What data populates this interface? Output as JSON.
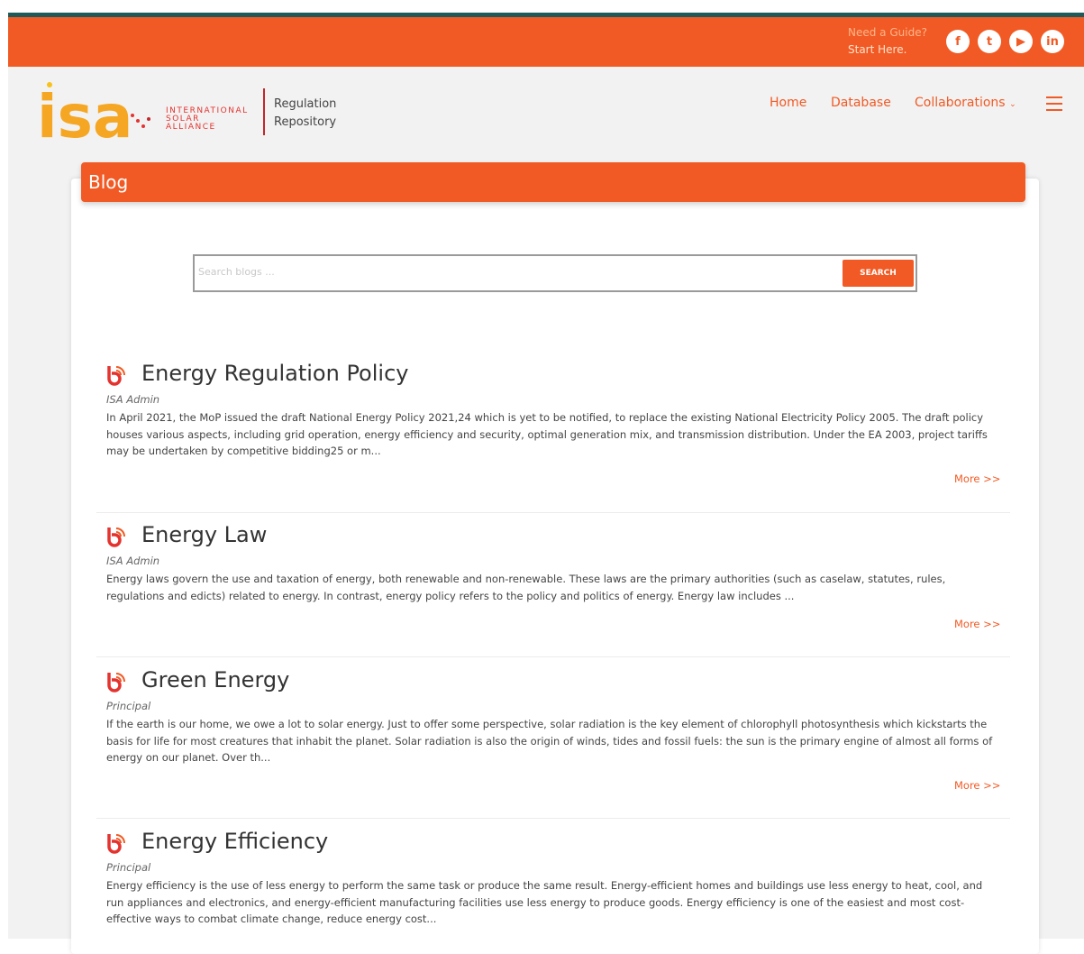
{
  "topbar": {
    "guide_line1": "Need a Guide?",
    "guide_line2": "Start Here.",
    "social": [
      {
        "icon": "facebook-icon",
        "glyph": "f"
      },
      {
        "icon": "twitter-icon",
        "glyph": "t"
      },
      {
        "icon": "youtube-icon",
        "glyph": "▶"
      },
      {
        "icon": "linkedin-icon",
        "glyph": "in"
      }
    ]
  },
  "header": {
    "logo_text": "isa",
    "logo_sub": [
      "INTERNATIONAL",
      "SOLAR",
      "ALLIANCE"
    ],
    "repo_line1": "Regulation",
    "repo_line2": "Repository",
    "nav": {
      "home": "Home",
      "database": "Database",
      "collaborations": "Collaborations"
    },
    "menu_icon": "hamburger-icon"
  },
  "blog": {
    "title": "Blog",
    "search_placeholder": "Search blogs ...",
    "search_button": "SEARCH",
    "posts": [
      {
        "title": "Energy Regulation Policy",
        "author": "ISA Admin",
        "body": "In April 2021, the MoP issued the draft National Energy Policy 2021,24 which is yet to be notified, to replace the existing National Electricity Policy 2005. The draft policy houses various aspects, including grid operation, energy efficiency and security, optimal generation mix, and transmission distribution. Under the EA 2003, project tariffs may be undertaken by competitive bidding25 or m...",
        "more": "More >>"
      },
      {
        "title": "Energy Law",
        "author": "ISA Admin",
        "body": "Energy laws govern the use and taxation of energy, both renewable and non-renewable. These laws are the primary authorities (such as caselaw, statutes, rules, regulations and edicts) related to energy. In contrast, energy policy refers to the policy and politics of energy. Energy law includes ...",
        "more": "More >>"
      },
      {
        "title": "Green Energy",
        "author": "Principal",
        "body": "If the earth is our home, we owe a lot to solar energy. Just to offer some perspective, solar radiation is the key element of chlorophyll photosynthesis which kickstarts the basis for life for most creatures that inhabit the planet. Solar radiation is also the origin of winds, tides and fossil fuels: the sun is the primary engine of almost all forms of energy on our planet. Over th...",
        "more": "More >>"
      },
      {
        "title": "Energy Efficiency",
        "author": "Principal",
        "body": "Energy efficiency is the use of less energy to perform the same task or produce the same result. Energy-efficient homes and buildings use less energy to heat, cool, and run appliances and electronics, and energy-efficient manufacturing facilities use less energy to produce goods. Energy efficiency is one of the easiest and most cost-effective ways to combat climate change, reduce energy cost...",
        "more": ""
      }
    ]
  },
  "colors": {
    "accent": "#f15a24",
    "stripe": "#1f5a5a",
    "page_bg": "#f2f2f2"
  }
}
